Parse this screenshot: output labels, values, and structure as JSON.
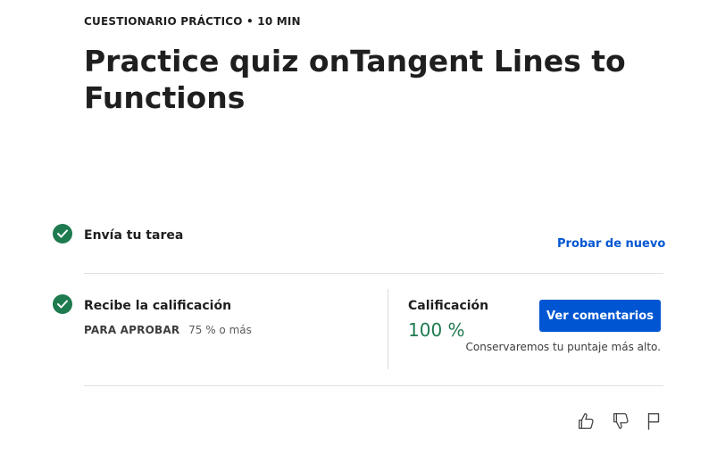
{
  "header": {
    "eyebrow": "CUESTIONARIO PRÁCTICO • 10 MIN",
    "title": "Practice quiz onTangent Lines to Functions"
  },
  "steps": [
    {
      "label": "Envía tu tarea",
      "status_icon": "check-circle-icon",
      "action": "Probar de nuevo"
    },
    {
      "label": "Recibe la calificación",
      "status_icon": "check-circle-icon",
      "pass_label": "PARA APROBAR",
      "pass_value": "75 % o más"
    }
  ],
  "grade": {
    "label": "Calificación",
    "value": "100 %",
    "feedback_button": "Ver comentarios",
    "note": "Conservaremos tu puntaje más alto."
  },
  "feedback_icons": [
    "thumbs-up-icon",
    "thumbs-down-icon",
    "flag-icon"
  ],
  "colors": {
    "accent": "#0056d2",
    "success": "#1e7a4f",
    "text": "#1f1f1f",
    "divider": "#e1e1e1"
  }
}
